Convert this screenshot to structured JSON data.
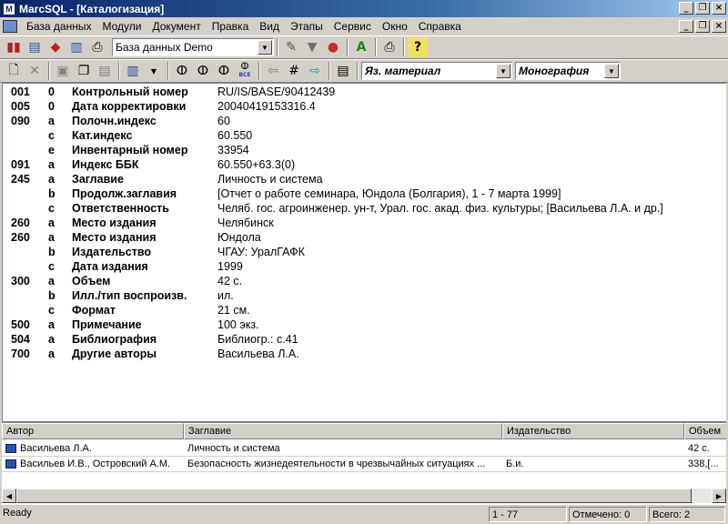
{
  "window": {
    "title": "MarcSQL - [Каталогизация]"
  },
  "menu": [
    "База данных",
    "Модули",
    "Документ",
    "Правка",
    "Вид",
    "Этапы",
    "Сервис",
    "Окно",
    "Справка"
  ],
  "toolbar": {
    "database_combo": "База данных Demo",
    "language_combo": "Яз. материал",
    "type_combo": "Монография",
    "all_label": "ВСЕ"
  },
  "record": [
    {
      "tag": "001",
      "sub": "0",
      "name": "Контрольный номер",
      "value": "RU/IS/BASE/90412439"
    },
    {
      "tag": "005",
      "sub": "0",
      "name": "Дата корректировки",
      "value": "20040419153316.4"
    },
    {
      "tag": "090",
      "sub": "a",
      "name": "Полочн.индекс",
      "value": "60"
    },
    {
      "tag": "",
      "sub": "c",
      "name": "Кат.индекс",
      "value": "60.550"
    },
    {
      "tag": "",
      "sub": "e",
      "name": "Инвентарный номер",
      "value": "33954"
    },
    {
      "tag": "091",
      "sub": "a",
      "name": "Индекс ББК",
      "value": "60.550+63.3(0)"
    },
    {
      "tag": "245",
      "sub": "a",
      "name": "Заглавие",
      "value": "Личность и система"
    },
    {
      "tag": "",
      "sub": "b",
      "name": "Продолж.заглавия",
      "value": "[Отчет о работе семинара, Юндола (Болгария), 1 - 7 марта 1999]"
    },
    {
      "tag": "",
      "sub": "c",
      "name": "Ответственность",
      "value": "Челяб. гос. агроинженер. ун-т, Урал. гос. акад. физ. культуры; [Васильева Л.А. и др.]"
    },
    {
      "tag": "260",
      "sub": "a",
      "name": "Место издания",
      "value": "Челябинск"
    },
    {
      "tag": "260",
      "sub": "a",
      "name": "Место издания",
      "value": "Юндола"
    },
    {
      "tag": "",
      "sub": "b",
      "name": "Издательство",
      "value": "ЧГАУ: УралГАФК"
    },
    {
      "tag": "",
      "sub": "c",
      "name": "Дата издания",
      "value": "1999"
    },
    {
      "tag": "300",
      "sub": "a",
      "name": "Объем",
      "value": "42 с."
    },
    {
      "tag": "",
      "sub": "b",
      "name": "Илл./тип воспроизв.",
      "value": "ил."
    },
    {
      "tag": "",
      "sub": "c",
      "name": "Формат",
      "value": "21 см."
    },
    {
      "tag": "500",
      "sub": "a",
      "name": "Примечание",
      "value": "100 экз."
    },
    {
      "tag": "504",
      "sub": "a",
      "name": "Библиография",
      "value": "Библиогр.: с.41"
    },
    {
      "tag": "700",
      "sub": "a",
      "name": "Другие авторы",
      "value": "Васильева Л.А."
    }
  ],
  "list": {
    "columns": [
      "Автор",
      "Заглавие",
      "Издательство",
      "Объем"
    ],
    "rows": [
      [
        "Васильева Л.А.",
        "Личность и система",
        "",
        "42 с."
      ],
      [
        "Васильев И.В., Островский А.М.",
        "Безопасность жизнедеятельности в чрезвычайных ситуациях ...",
        "Б.и.",
        "338,[..."
      ]
    ]
  },
  "status": {
    "ready": "Ready",
    "range": "1 - 77",
    "marked": "Отмечено: 0",
    "total": "Всего: 2"
  }
}
